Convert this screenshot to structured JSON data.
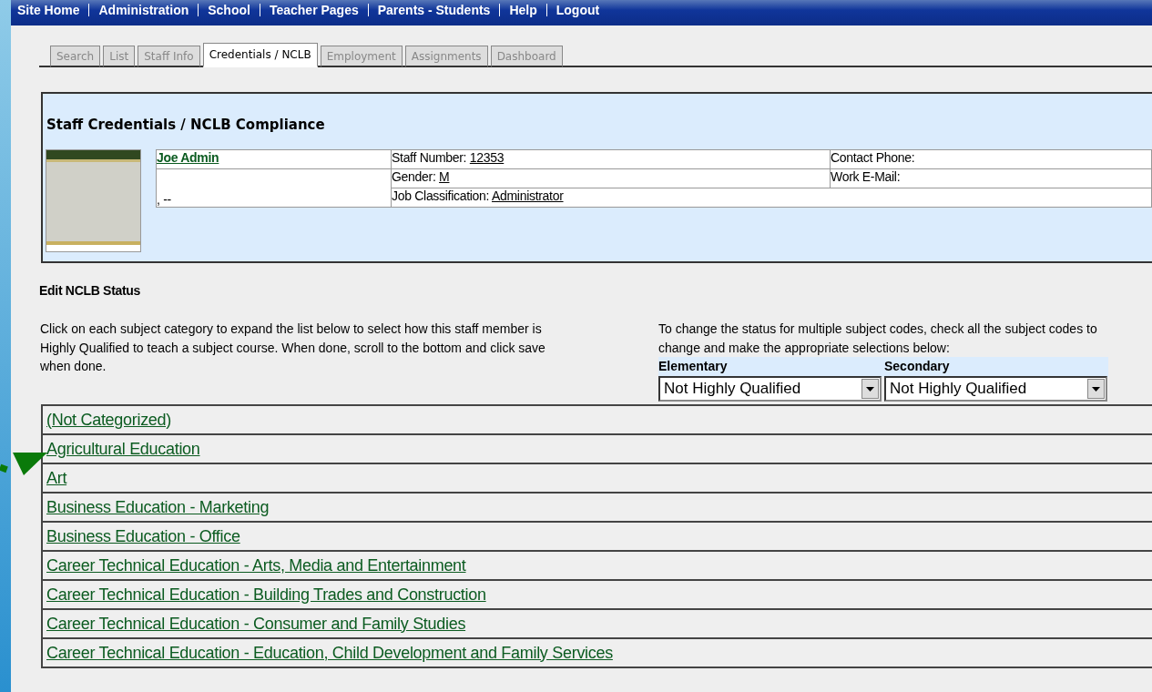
{
  "nav": [
    "Site Home",
    "Administration",
    "School",
    "Teacher Pages",
    "Parents - Students",
    "Help",
    "Logout"
  ],
  "tabs": [
    {
      "label": "Search",
      "selected": false
    },
    {
      "label": "List",
      "selected": false
    },
    {
      "label": "Staff Info",
      "selected": false
    },
    {
      "label": "Credentials / NCLB",
      "selected": true
    },
    {
      "label": "Employment",
      "selected": false
    },
    {
      "label": "Assignments",
      "selected": false
    },
    {
      "label": "Dashboard",
      "selected": false
    }
  ],
  "panel": {
    "title": "Staff Credentials / NCLB Compliance",
    "name": "Joe Admin",
    "address": ", --",
    "staff_number_label": "Staff Number:",
    "staff_number": "12353",
    "gender_label": "Gender:",
    "gender": "M",
    "job_label": "Job Classification:",
    "job": "Administrator",
    "phone_label": "Contact Phone:",
    "email_label": "Work E-Mail:"
  },
  "section_title": "Edit NCLB Status",
  "instructions": "Click on each subject category to expand the list below to select how this staff member is Highly Qualified to teach a subject course. When done, scroll to the bottom and click save when done.",
  "bulk": {
    "text": "To change the status for multiple subject codes, check all the subject codes to change and make the appropriate selections below:",
    "selects": [
      {
        "label": "Elementary",
        "value": "Not Highly Qualified"
      },
      {
        "label": "Secondary",
        "value": "Not Highly Qualified"
      }
    ]
  },
  "categories": [
    "(Not Categorized)",
    "Agricultural Education",
    "Art",
    "Business Education - Marketing",
    "Business Education - Office",
    "Career Technical Education - Arts, Media and Entertainment",
    "Career Technical Education - Building Trades and Construction",
    "Career Technical Education - Consumer and Family Studies",
    "Career Technical Education - Education, Child Development and Family Services"
  ]
}
